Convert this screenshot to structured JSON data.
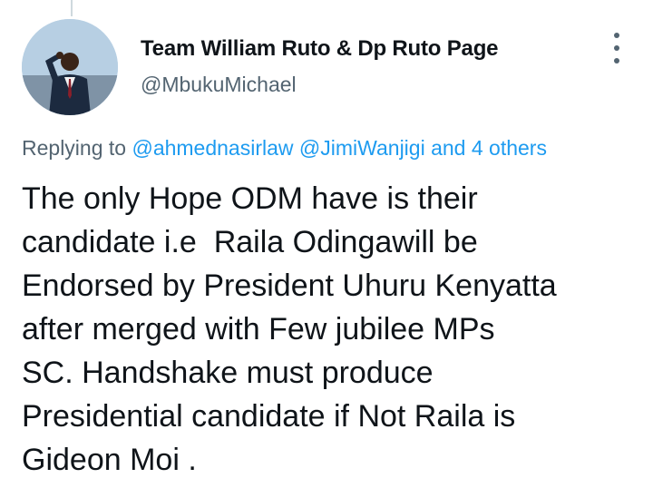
{
  "tweet": {
    "author_name": "Team William Ruto & Dp Ruto Page",
    "author_handle": "@MbukuMichael",
    "replying_prefix": "Replying to ",
    "reply_mention_1": "@ahmednasirlaw",
    "reply_mention_2": "@JimiWanjigi",
    "reply_and": " and ",
    "reply_others": "4 others",
    "text_lines": [
      "The only Hope ODM have is their",
      "candidate i.e  Raila Odingawill be",
      "Endorsed by President Uhuru Kenyatta",
      "after merged with Few jubilee MPs",
      "SC. Handshake must produce",
      "Presidential candidate if Not Raila is",
      "Gideon Moi ."
    ]
  },
  "colors": {
    "link": "#1d9bf0",
    "secondary_text": "#536471",
    "primary_text": "#0f1419"
  },
  "icons": {
    "more": "more-vertical-icon"
  }
}
